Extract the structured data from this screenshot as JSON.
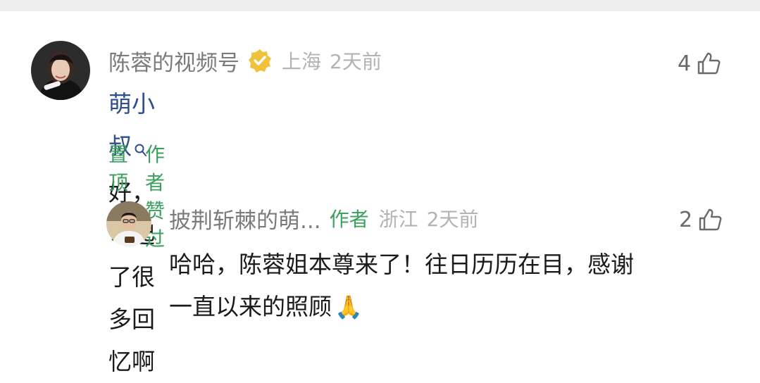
{
  "comment": {
    "author": "陈蓉的视频号",
    "verified_icon": "verified-badge-icon",
    "location": "上海",
    "time": "2天前",
    "likes": "4",
    "mention": "萌小叔",
    "text": "好，勾起了很多回忆啊",
    "actions": {
      "pin": "置顶",
      "author_liked": "作者赞过"
    }
  },
  "reply": {
    "author": "披荆斩棘的萌...",
    "badge": "作者",
    "location": "浙江",
    "time": "2天前",
    "likes": "2",
    "text_line1": "哈哈，陈蓉姐本尊来了！往日历历在目，感谢",
    "text_line2": "一直以来的照顾",
    "emoji": "🙏"
  },
  "colors": {
    "accent_green": "#3aa05d",
    "mention_blue": "#2e4f8e",
    "name_gray": "#7b7b7b",
    "meta_gray": "#b3b3b3",
    "badge_gold": "#f0c23a"
  }
}
